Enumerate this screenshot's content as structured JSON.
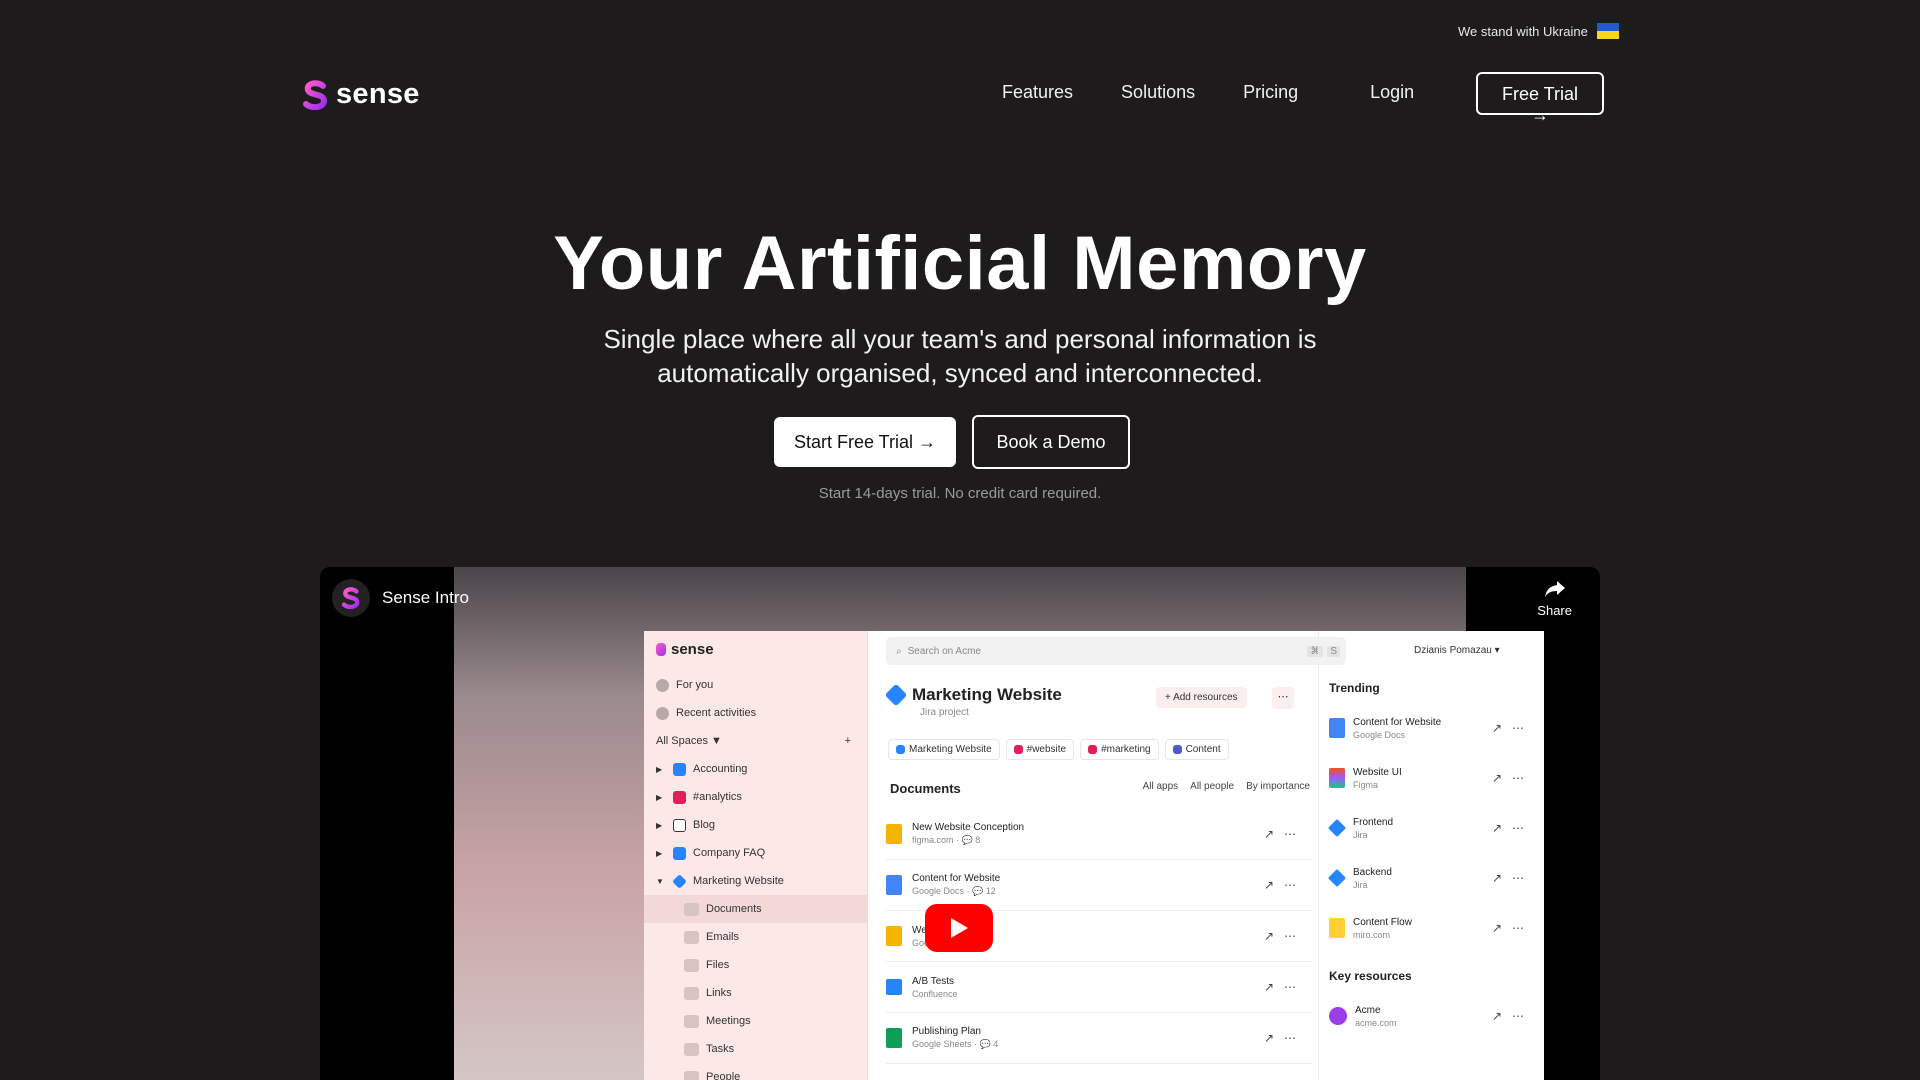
{
  "banner": {
    "ukraine_text": "We stand with Ukraine",
    "flag_colors": [
      "#1f5bc9",
      "#f9d616"
    ]
  },
  "brand": {
    "name": "sense",
    "gradient": [
      "#b537f2",
      "#ff5cc8"
    ]
  },
  "nav": {
    "links": [
      "Features",
      "Solutions",
      "Pricing"
    ],
    "login": "Login",
    "free_trial": "Free Trial →"
  },
  "hero": {
    "title": "Your Artificial Memory",
    "subtitle_line1": "Single place where all your team's and personal information is",
    "subtitle_line2": "automatically organised, synced and interconnected.",
    "primary_cta": "Start Free Trial →",
    "secondary_cta": "Book a Demo",
    "note": "Start 14-days trial. No credit card required."
  },
  "video": {
    "title": "Sense Intro",
    "share": "Share",
    "app": {
      "logo": "sense",
      "search_placeholder": "Search on Acme",
      "search_keys": [
        "⌘",
        "S"
      ],
      "user": "Dzianis Pomazau",
      "sidebar": {
        "for_you": "For you",
        "recent": "Recent activities",
        "all_spaces": "All Spaces",
        "spaces": [
          {
            "label": "Accounting",
            "icon": "confluence-icon"
          },
          {
            "label": "#analytics",
            "icon": "slack-icon"
          },
          {
            "label": "Blog",
            "icon": "notion-icon"
          },
          {
            "label": "Company FAQ",
            "icon": "confluence-icon"
          },
          {
            "label": "Marketing Website",
            "icon": "jira-icon"
          }
        ],
        "folders": [
          "Documents",
          "Emails",
          "Files",
          "Links",
          "Meetings",
          "Tasks",
          "People"
        ]
      },
      "project": {
        "title": "Marketing Website",
        "subtitle": "Jira project",
        "add_resources": "Add resources",
        "chips": [
          "Marketing Website",
          "#website",
          "#marketing",
          "Content"
        ]
      },
      "documents": {
        "title": "Documents",
        "filters": [
          "All apps",
          "All people",
          "By importance"
        ],
        "rows": [
          {
            "name": "New Website Conception",
            "meta": "figma.com · 💬 8",
            "color": "#f4b400"
          },
          {
            "name": "Content for Website",
            "meta": "Google Docs · 💬 12",
            "color": "#4285f4"
          },
          {
            "name": "Website Flow",
            "meta": "Google Slides",
            "color": "#f4b400"
          },
          {
            "name": "A/B Tests",
            "meta": "Confluence",
            "color": "#2684ff"
          },
          {
            "name": "Publishing Plan",
            "meta": "Google Sheets · 💬 4",
            "color": "#0f9d58"
          }
        ]
      },
      "trending": {
        "title": "Trending",
        "rows": [
          {
            "name": "Content for Website",
            "meta": "Google Docs",
            "color": "#4285f4"
          },
          {
            "name": "Website UI",
            "meta": "Figma",
            "color": "#f24e1e"
          },
          {
            "name": "Frontend",
            "meta": "Jira",
            "color": "#2684ff"
          },
          {
            "name": "Backend",
            "meta": "Jira",
            "color": "#2684ff"
          },
          {
            "name": "Content Flow",
            "meta": "miro.com",
            "color": "#ffd02f"
          }
        ]
      },
      "key_resources": {
        "title": "Key resources",
        "rows": [
          {
            "name": "Acme",
            "meta": "acme.com",
            "color": "#9b3de8"
          }
        ]
      }
    }
  }
}
